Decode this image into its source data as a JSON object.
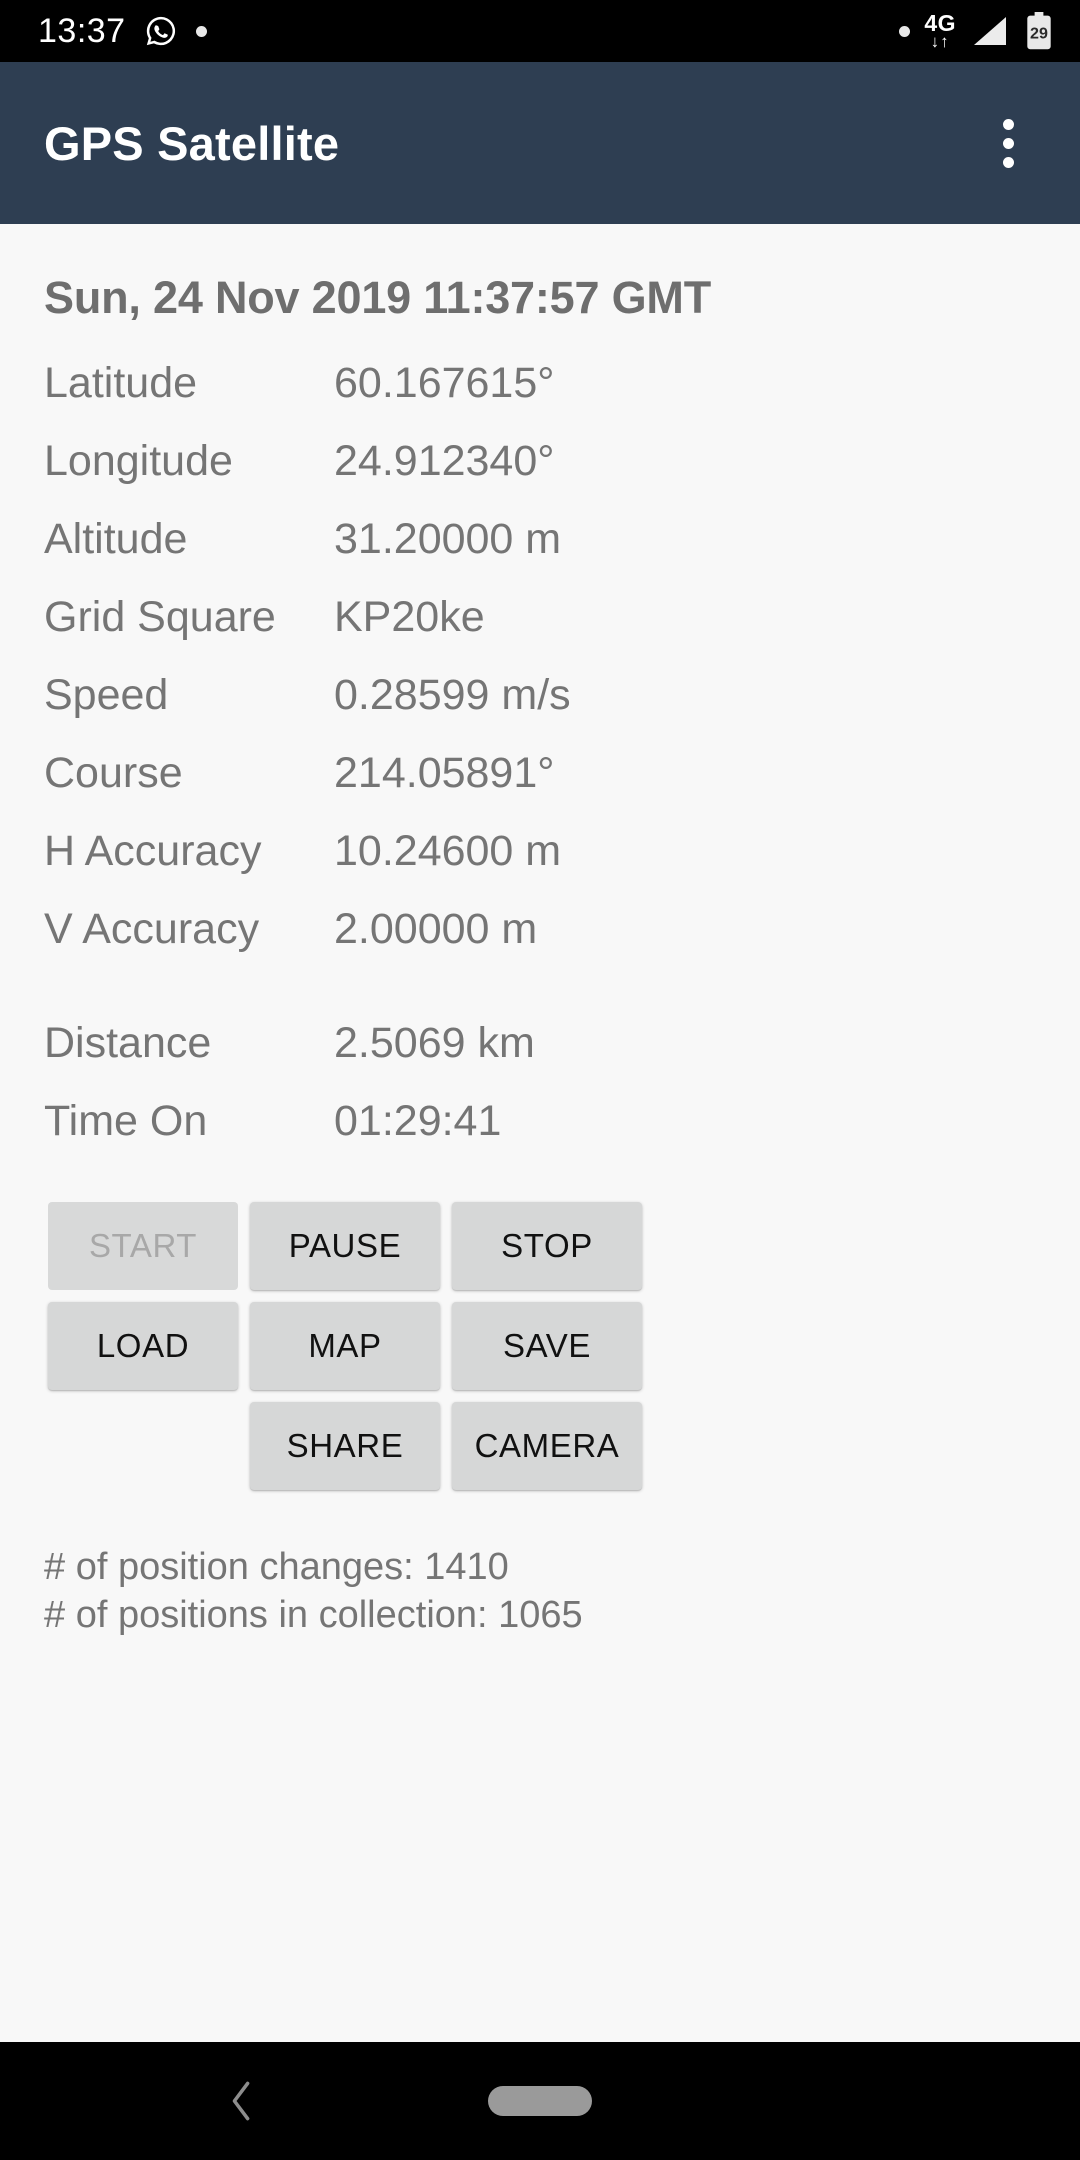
{
  "status_bar": {
    "time": "13:37",
    "whatsapp_icon": "whatsapp-icon",
    "notification_dot": "notification-dot-icon",
    "right_dot": "status-dot-icon",
    "network_type": "4G",
    "data_arrows": "↓↑",
    "signal_icon": "signal-bars-icon",
    "battery_level": "29"
  },
  "app_bar": {
    "title": "GPS Satellite",
    "overflow_icon": "overflow-menu-icon"
  },
  "main": {
    "timestamp": "Sun, 24 Nov 2019 11:37:57 GMT",
    "position_rows": [
      {
        "label": "Latitude",
        "value": "60.167615°"
      },
      {
        "label": "Longitude",
        "value": "24.912340°"
      },
      {
        "label": "Altitude",
        "value": "31.20000 m"
      },
      {
        "label": "Grid Square",
        "value": "KP20ke"
      },
      {
        "label": "Speed",
        "value": "0.28599 m/s"
      },
      {
        "label": "Course",
        "value": "214.05891°"
      },
      {
        "label": "H Accuracy",
        "value": "10.24600 m"
      },
      {
        "label": "V Accuracy",
        "value": "2.00000 m"
      }
    ],
    "track_rows": [
      {
        "label": "Distance",
        "value": "2.5069 km"
      },
      {
        "label": "Time On",
        "value": "01:29:41"
      }
    ],
    "buttons": [
      {
        "label": "START",
        "enabled": false
      },
      {
        "label": "PAUSE",
        "enabled": true
      },
      {
        "label": "STOP",
        "enabled": true
      },
      {
        "label": "LOAD",
        "enabled": true
      },
      {
        "label": "MAP",
        "enabled": true
      },
      {
        "label": "SAVE",
        "enabled": true
      },
      {
        "label": "SHARE",
        "enabled": true
      },
      {
        "label": "CAMERA",
        "enabled": true
      }
    ],
    "stats": [
      "# of position changes:  1410",
      "# of positions in collection:  1065"
    ]
  },
  "nav_bar": {
    "back_icon": "back-chevron-icon",
    "home_pill": "home-pill-icon"
  },
  "colors": {
    "app_bar": "#2e3e52",
    "page_bg": "#f8f8f8",
    "text": "#757575",
    "button_bg": "#d6d7d7",
    "status_bg": "#000000"
  }
}
